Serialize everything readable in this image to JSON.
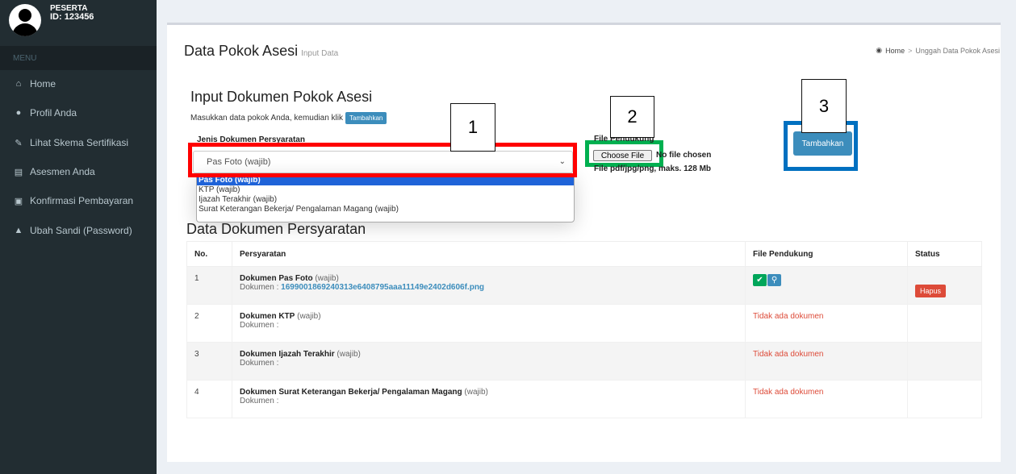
{
  "user": {
    "name": "PESERTA",
    "id": "ID: 123456"
  },
  "sidebar": {
    "header": "MENU",
    "items": [
      {
        "label": "Home",
        "icon": "home-icon"
      },
      {
        "label": "Profil Anda",
        "icon": "user-icon"
      },
      {
        "label": "Lihat Skema Sertifikasi",
        "icon": "edit-icon"
      },
      {
        "label": "Asesmen Anda",
        "icon": "file-icon"
      },
      {
        "label": "Konfirmasi Pembayaran",
        "icon": "money-icon"
      },
      {
        "label": "Ubah Sandi (Password)",
        "icon": "lock-icon"
      }
    ]
  },
  "page": {
    "title": "Data Pokok Asesi",
    "subtitle": "Input Data"
  },
  "breadcrumb": {
    "home": "Home",
    "current": "Unggah Data Pokok Asesi"
  },
  "form": {
    "title": "Input Dokumen Pokok Asesi",
    "instruction": "Masukkan data pokok Anda, kemudian klik",
    "instruction_button": "Tambahkan",
    "select_label": "Jenis Dokumen Persyaratan",
    "select_value": "Pas Foto (wajib)",
    "options": [
      "Pas Foto (wajib)",
      "KTP (wajib)",
      "Ijazah Terakhir (wajib)",
      "Surat Keterangan Bekerja/ Pengalaman Magang (wajib)"
    ],
    "file_label": "File Pendukung",
    "choose_file": "Choose File",
    "no_file": "No file chosen",
    "file_hint": "File pdf/jpg/png, maks. 128 Mb",
    "submit": "Tambahkan"
  },
  "annotations": {
    "n1": "1",
    "n2": "2",
    "n3": "3",
    "red": "#ff0000",
    "green": "#00b050",
    "blue": "#0070c0"
  },
  "table": {
    "title": "Data Dokumen Persyaratan",
    "headers": [
      "No.",
      "Persyaratan",
      "File Pendukung",
      "Status"
    ],
    "rows": [
      {
        "no": "1",
        "name": "Dokumen Pas Foto",
        "req": " (wajib)",
        "doc_label": "Dokumen : ",
        "doc_file": "1699001869240313e6408795aaa11149e2402d606f.png",
        "has_file": true,
        "status": "Hapus"
      },
      {
        "no": "2",
        "name": "Dokumen KTP",
        "req": " (wajib)",
        "doc_label": "Dokumen :",
        "doc_file": "",
        "file_text": "Tidak ada dokumen"
      },
      {
        "no": "3",
        "name": "Dokumen Ijazah Terakhir",
        "req": " (wajib)",
        "doc_label": "Dokumen :",
        "doc_file": "",
        "file_text": "Tidak ada dokumen"
      },
      {
        "no": "4",
        "name": "Dokumen Surat Keterangan Bekerja/ Pengalaman Magang",
        "req": " (wajib)",
        "doc_label": "Dokumen :",
        "doc_file": "",
        "file_text": "Tidak ada dokumen"
      }
    ]
  }
}
